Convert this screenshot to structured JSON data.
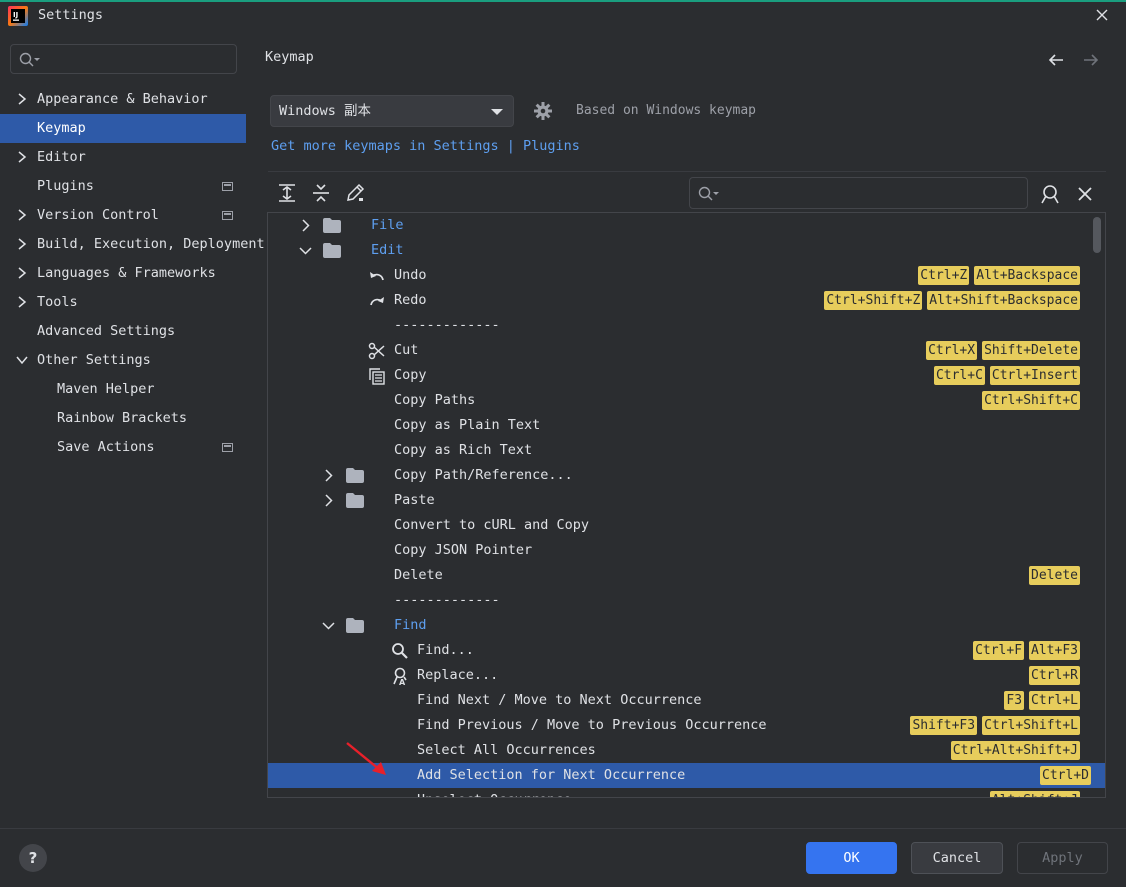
{
  "window": {
    "title": "Settings"
  },
  "sidebar": {
    "search_placeholder": "",
    "items": [
      {
        "label": "Appearance & Behavior",
        "expandable": true
      },
      {
        "label": "Keymap",
        "selected": true
      },
      {
        "label": "Editor",
        "expandable": true
      },
      {
        "label": "Plugins",
        "page_icon": true
      },
      {
        "label": "Version Control",
        "expandable": true,
        "page_icon": true
      },
      {
        "label": "Build, Execution, Deployment",
        "expandable": true
      },
      {
        "label": "Languages & Frameworks",
        "expandable": true
      },
      {
        "label": "Tools",
        "expandable": true
      },
      {
        "label": "Advanced Settings"
      },
      {
        "label": "Other Settings",
        "expanded": true
      },
      {
        "label": "Maven Helper",
        "sub": true
      },
      {
        "label": "Rainbow Brackets",
        "sub": true
      },
      {
        "label": "Save Actions",
        "sub": true,
        "page_icon": true
      }
    ]
  },
  "main": {
    "title": "Keymap",
    "keymap_select": "Windows 副本",
    "based_on": "Based on Windows keymap",
    "link_prefix": "Get more keymaps in Settings",
    "link_separator": "|",
    "link_plugins": "Plugins",
    "tree_search_placeholder": ""
  },
  "tree": [
    {
      "label": "File",
      "level": 0,
      "type": "folder",
      "expand": "collapsed",
      "blue": true,
      "shortcuts": []
    },
    {
      "label": "Edit",
      "level": 0,
      "type": "folder",
      "expand": "expanded",
      "blue": true,
      "shortcuts": []
    },
    {
      "label": "Undo",
      "level": 1,
      "icon": "undo-icon",
      "shortcuts": [
        "Ctrl+Z",
        "Alt+Backspace"
      ]
    },
    {
      "label": "Redo",
      "level": 1,
      "icon": "redo-icon",
      "shortcuts": [
        "Ctrl+Shift+Z",
        "Alt+Shift+Backspace"
      ]
    },
    {
      "label": "-------------",
      "level": 1,
      "separator": true,
      "shortcuts": []
    },
    {
      "label": "Cut",
      "level": 1,
      "icon": "scissors-icon",
      "shortcuts": [
        "Ctrl+X",
        "Shift+Delete"
      ]
    },
    {
      "label": "Copy",
      "level": 1,
      "icon": "copy-icon",
      "shortcuts": [
        "Ctrl+C",
        "Ctrl+Insert"
      ]
    },
    {
      "label": "Copy Paths",
      "level": 1,
      "shortcuts": [
        "Ctrl+Shift+C"
      ]
    },
    {
      "label": "Copy as Plain Text",
      "level": 1,
      "shortcuts": []
    },
    {
      "label": "Copy as Rich Text",
      "level": 1,
      "shortcuts": []
    },
    {
      "label": "Copy Path/Reference...",
      "level": 1,
      "type": "folder",
      "expand": "collapsed",
      "shortcuts": []
    },
    {
      "label": "Paste",
      "level": 1,
      "type": "folder",
      "expand": "collapsed",
      "shortcuts": []
    },
    {
      "label": "Convert to cURL and Copy",
      "level": 1,
      "shortcuts": []
    },
    {
      "label": "Copy JSON Pointer",
      "level": 1,
      "shortcuts": []
    },
    {
      "label": "Delete",
      "level": 1,
      "shortcuts": [
        "Delete"
      ]
    },
    {
      "label": "-------------",
      "level": 1,
      "separator": true,
      "shortcuts": []
    },
    {
      "label": "Find",
      "level": 1,
      "type": "folder",
      "expand": "expanded",
      "blue": true,
      "shortcuts": []
    },
    {
      "label": "Find...",
      "level": 2,
      "icon": "search-icon",
      "shortcuts": [
        "Ctrl+F",
        "Alt+F3"
      ]
    },
    {
      "label": "Replace...",
      "level": 2,
      "icon": "replace-icon",
      "shortcuts": [
        "Ctrl+R"
      ]
    },
    {
      "label": "Find Next / Move to Next Occurrence",
      "level": 2,
      "shortcuts": [
        "F3",
        "Ctrl+L"
      ]
    },
    {
      "label": "Find Previous / Move to Previous Occurrence",
      "level": 2,
      "shortcuts": [
        "Shift+F3",
        "Ctrl+Shift+L"
      ]
    },
    {
      "label": "Select All Occurrences",
      "level": 2,
      "shortcuts": [
        "Ctrl+Alt+Shift+J"
      ]
    },
    {
      "label": "Add Selection for Next Occurrence",
      "level": 2,
      "selected": true,
      "shortcuts": [
        "Ctrl+D"
      ]
    },
    {
      "label": "Unselect Occurrence",
      "level": 2,
      "shortcuts": [
        "Alt+Shift+J"
      ]
    }
  ],
  "footer": {
    "help": "?",
    "ok": "OK",
    "cancel": "Cancel",
    "apply": "Apply"
  },
  "colors": {
    "background": "#2b2d30",
    "selection": "#2e5aa8",
    "link": "#5e9ff0",
    "shortcut_badge": "#e7cd5c",
    "primary_button": "#3574f0",
    "annotation_arrow": "#e8202a"
  }
}
